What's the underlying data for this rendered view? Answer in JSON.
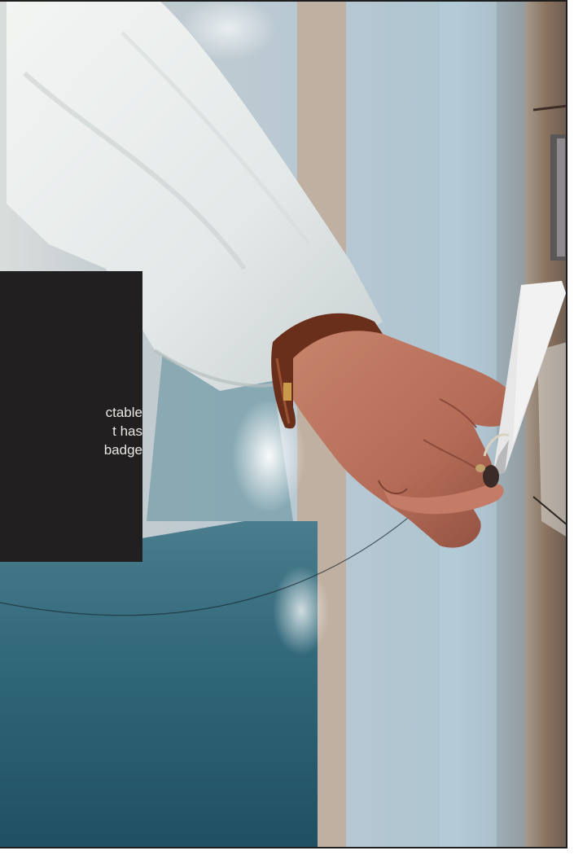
{
  "card": {
    "lines": [
      "ctable",
      "t has",
      "badge"
    ]
  },
  "icons": {
    "photo": "hand-holding-access-card-photo"
  },
  "colors": {
    "card_bg": "#221f20",
    "card_text": "#e9e6e3",
    "wall": "#b8c9d4",
    "corridor": "#2f6678",
    "sleeve": "#e8ecec",
    "skin": "#b46c57",
    "watch_strap": "#6a2f1b",
    "card": "#e7e7e8",
    "panel": "#8a725f"
  }
}
